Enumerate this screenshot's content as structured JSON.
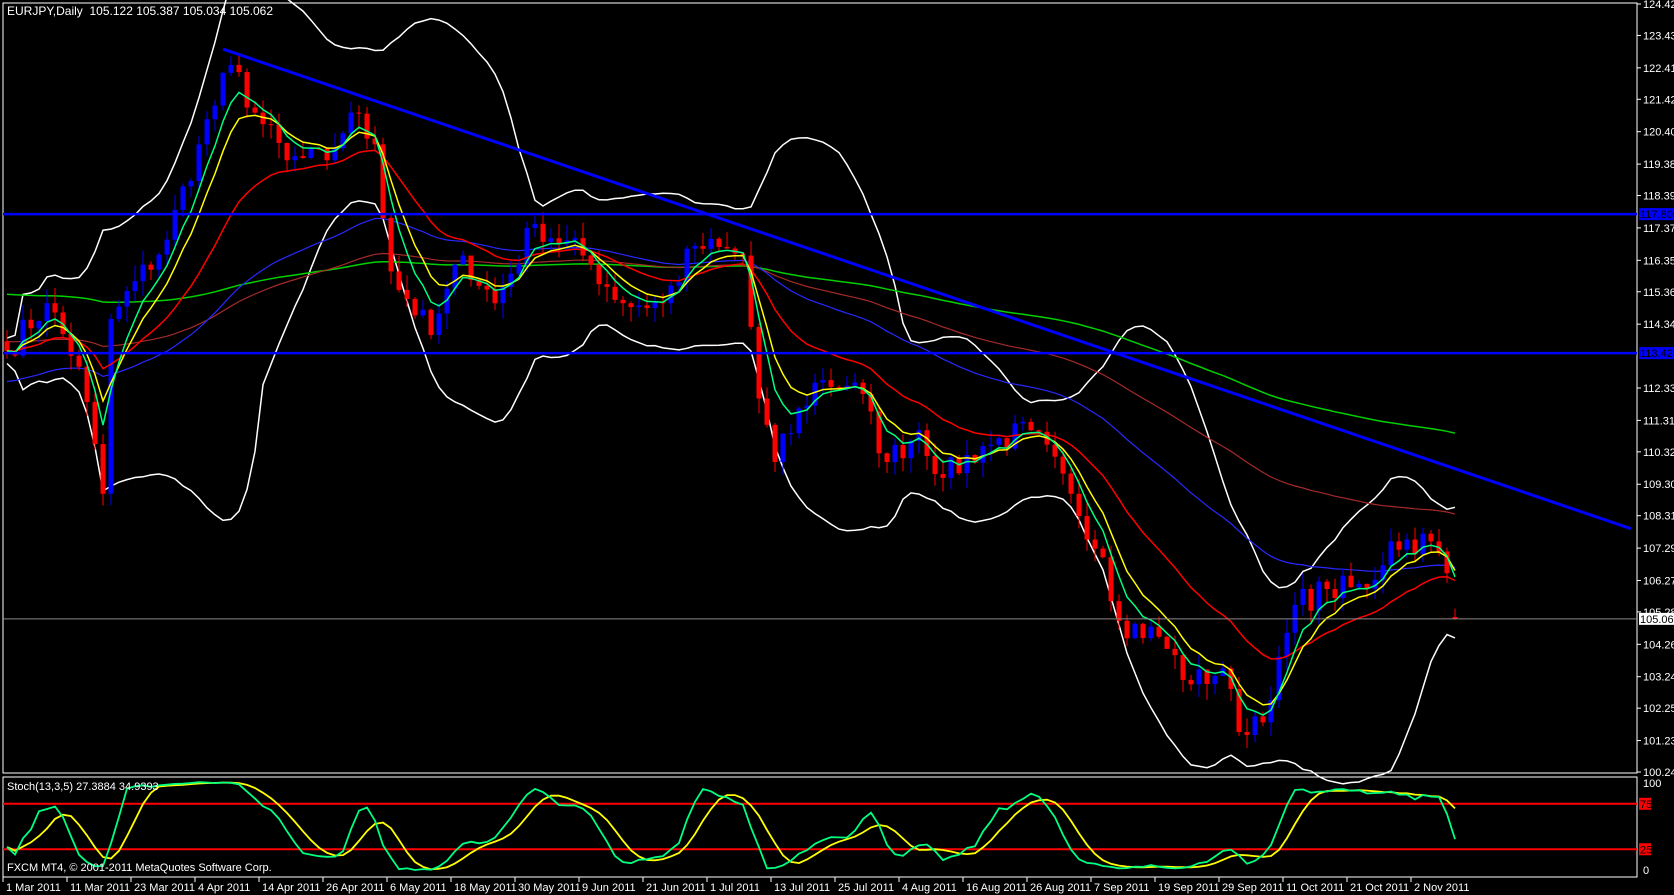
{
  "header": {
    "symbol": "EURJPY,Daily",
    "ohlc": "105.122 105.387 105.034 105.062"
  },
  "stoch": {
    "label": "Stoch(13,3,5) 27.3884 34.9393",
    "levels": [
      "75",
      "25"
    ],
    "scale": [
      "100",
      "0"
    ]
  },
  "footer": {
    "copyright": "FXCM MT4, © 2001-2011 MetaQuotes Software Corp."
  },
  "colors": {
    "bull": "#0000ff",
    "bear": "#ff0000",
    "ma5": "#00ff80",
    "ma8": "#ffff00",
    "ma21": "#ff0000",
    "ma55": "#2828ff",
    "ma100": "#a52a2a",
    "ma200": "#00d000",
    "bands": "#ffffff",
    "hline": "#0000ff",
    "stochK": "#00ff80",
    "stochD": "#ffff00"
  },
  "chart_data": {
    "type": "candlestick",
    "symbol": "EURJPY",
    "timeframe": "Daily",
    "ylim": [
      100.24,
      124.42
    ],
    "price_ticks": [
      "124.420",
      "123.430",
      "122.410",
      "121.420",
      "120.400",
      "119.380",
      "118.390",
      "117.370",
      "116.350",
      "115.360",
      "114.340",
      "112.330",
      "111.310",
      "110.320",
      "109.300",
      "108.310",
      "107.290",
      "106.270",
      "105.280",
      "104.260",
      "103.240",
      "102.250",
      "101.230",
      "100.240"
    ],
    "current_price": "105.062",
    "horizontal_lines": [
      "117.805",
      "113.428"
    ],
    "trendline": {
      "from": [
        27,
        123.0
      ],
      "to": [
        203,
        107.9
      ]
    },
    "time_labels": [
      {
        "bar": 0,
        "label": "1 Mar 2011"
      },
      {
        "bar": 8,
        "label": "11 Mar 2011"
      },
      {
        "bar": 16,
        "label": "23 Mar 2011"
      },
      {
        "bar": 24,
        "label": "4 Apr 2011"
      },
      {
        "bar": 32,
        "label": "14 Apr 2011"
      },
      {
        "bar": 40,
        "label": "26 Apr 2011"
      },
      {
        "bar": 48,
        "label": "6 May 2011"
      },
      {
        "bar": 56,
        "label": "18 May 2011"
      },
      {
        "bar": 64,
        "label": "30 May 2011"
      },
      {
        "bar": 72,
        "label": "9 Jun 2011"
      },
      {
        "bar": 80,
        "label": "21 Jun 2011"
      },
      {
        "bar": 88,
        "label": "1 Jul 2011"
      },
      {
        "bar": 96,
        "label": "13 Jul 2011"
      },
      {
        "bar": 104,
        "label": "25 Jul 2011"
      },
      {
        "bar": 112,
        "label": "4 Aug 2011"
      },
      {
        "bar": 120,
        "label": "16 Aug 2011"
      },
      {
        "bar": 128,
        "label": "26 Aug 2011"
      },
      {
        "bar": 136,
        "label": "7 Sep 2011"
      },
      {
        "bar": 144,
        "label": "19 Sep 2011"
      },
      {
        "bar": 152,
        "label": "29 Sep 2011"
      },
      {
        "bar": 160,
        "label": "11 Oct 2011"
      },
      {
        "bar": 168,
        "label": "21 Oct 2011"
      },
      {
        "bar": 176,
        "label": "2 Nov 2011"
      }
    ],
    "close_keyframes": [
      [
        0,
        113.5
      ],
      [
        5,
        115
      ],
      [
        9,
        113
      ],
      [
        12,
        109
      ],
      [
        13,
        114.5
      ],
      [
        20,
        117
      ],
      [
        24,
        120
      ],
      [
        28,
        122.5
      ],
      [
        31,
        121
      ],
      [
        35,
        119.5
      ],
      [
        40,
        119.5
      ],
      [
        43,
        121
      ],
      [
        46,
        120
      ],
      [
        48,
        116
      ],
      [
        53,
        114
      ],
      [
        57,
        116.5
      ],
      [
        61,
        115
      ],
      [
        66,
        117.5
      ],
      [
        72,
        116.5
      ],
      [
        77,
        115
      ],
      [
        82,
        115
      ],
      [
        86,
        116.8
      ],
      [
        92,
        116.5
      ],
      [
        94,
        112
      ],
      [
        96,
        110
      ],
      [
        101,
        112.5
      ],
      [
        106,
        112.5
      ],
      [
        110,
        110
      ],
      [
        114,
        111
      ],
      [
        117,
        109.5
      ],
      [
        122,
        110.5
      ],
      [
        128,
        111
      ],
      [
        133,
        109
      ],
      [
        137,
        107
      ],
      [
        139,
        105
      ],
      [
        144,
        104.5
      ],
      [
        148,
        103
      ],
      [
        152,
        103.5
      ],
      [
        154,
        101.5
      ],
      [
        158,
        102.5
      ],
      [
        161,
        105.5
      ],
      [
        165,
        106
      ],
      [
        170,
        106
      ],
      [
        173,
        107.5
      ],
      [
        178,
        107.5
      ],
      [
        180,
        106.5
      ],
      [
        181,
        105.062
      ]
    ],
    "indicators": [
      "MA 5",
      "MA 8",
      "MA 21",
      "MA 55",
      "MA 100",
      "MA 200",
      "Bollinger Bands",
      "Stochastic(13,3,5)"
    ]
  }
}
